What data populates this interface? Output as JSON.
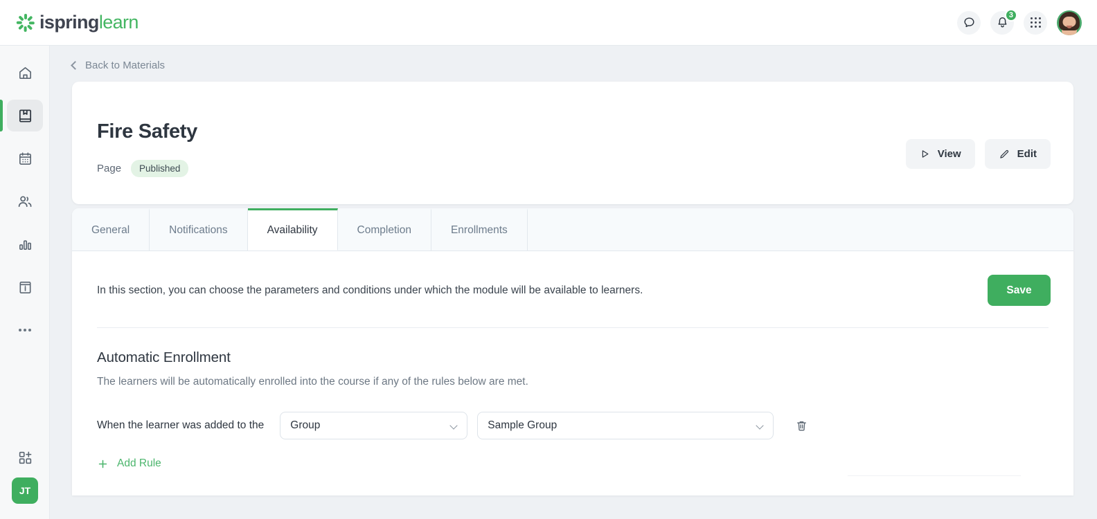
{
  "brand": {
    "name_bold": "ispring",
    "name_light": "learn",
    "accent": "#44b662"
  },
  "topbar": {
    "chat_icon": "chat-bubble-icon",
    "notifications_icon": "bell-icon",
    "notifications_count": "3",
    "apps_icon": "apps-grid-icon",
    "avatar_name": "user-avatar"
  },
  "sidebar": {
    "items": [
      {
        "name": "home",
        "icon": "home-icon",
        "active": false
      },
      {
        "name": "materials",
        "icon": "book-icon",
        "active": true
      },
      {
        "name": "calendar",
        "icon": "calendar-icon",
        "active": false
      },
      {
        "name": "users",
        "icon": "users-icon",
        "active": false
      },
      {
        "name": "reports",
        "icon": "bar-chart-icon",
        "active": false
      },
      {
        "name": "info",
        "icon": "info-panel-icon",
        "active": false
      },
      {
        "name": "more",
        "icon": "ellipsis-icon",
        "active": false
      }
    ],
    "add_app_icon": "grid-plus-icon",
    "user_initials": "JT"
  },
  "breadcrumb": {
    "back_label": "Back to Materials",
    "icon": "chevron-left-icon"
  },
  "hero": {
    "title": "Fire Safety",
    "type": "Page",
    "status": "Published",
    "view_label": "View",
    "view_icon": "play-icon",
    "edit_label": "Edit",
    "edit_icon": "pencil-icon"
  },
  "tabs": [
    {
      "label": "General",
      "active": false
    },
    {
      "label": "Notifications",
      "active": false
    },
    {
      "label": "Availability",
      "active": true
    },
    {
      "label": "Completion",
      "active": false
    },
    {
      "label": "Enrollments",
      "active": false
    }
  ],
  "panel": {
    "description": "In this section, you can choose the parameters and conditions under which the module will be available to learners.",
    "save_label": "Save",
    "section_title": "Automatic Enrollment",
    "section_subtitle": "The learners will be automatically enrolled into the course if any of the rules below are met.",
    "rule": {
      "label": "When the learner was added to the",
      "scope_value": "Group",
      "target_value": "Sample Group",
      "delete_icon": "trash-icon"
    },
    "add_rule_label": "Add Rule",
    "add_rule_icon": "plus-icon"
  }
}
